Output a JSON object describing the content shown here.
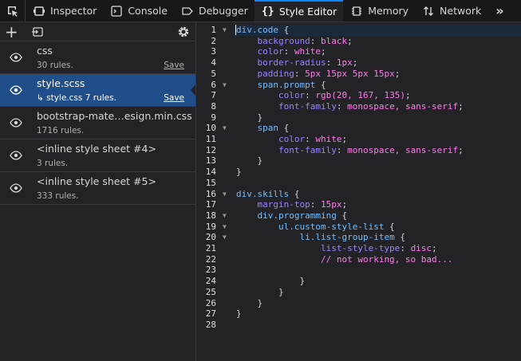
{
  "toolbar": {
    "tabs": [
      {
        "label": "Inspector",
        "icon": "inspector-icon"
      },
      {
        "label": "Console",
        "icon": "console-icon"
      },
      {
        "label": "Debugger",
        "icon": "debugger-icon"
      },
      {
        "label": "Style Editor",
        "icon": "style-editor-icon",
        "selected": true
      },
      {
        "label": "Memory",
        "icon": "memory-icon"
      },
      {
        "label": "Network",
        "icon": "network-icon"
      }
    ],
    "more_label": "»"
  },
  "sidebar": {
    "add_label": "+",
    "sheets": [
      {
        "name": "css",
        "meta": "30 rules.",
        "save": "Save"
      },
      {
        "name": "style.scss",
        "meta": "↳ style.css  7 rules.",
        "save": "Save",
        "selected": true
      },
      {
        "name": "bootstrap-mate…esign.min.css",
        "meta": "1716 rules.",
        "save": ""
      },
      {
        "name": "<inline style sheet #4>",
        "meta": "3 rules.",
        "save": ""
      },
      {
        "name": "<inline style sheet #5>",
        "meta": "333 rules.",
        "save": ""
      }
    ]
  },
  "editor": {
    "lines": [
      {
        "n": "1",
        "fold": true,
        "code": "div.code {"
      },
      {
        "n": "2",
        "code": "    background: black;"
      },
      {
        "n": "3",
        "code": "    color: white;"
      },
      {
        "n": "4",
        "code": "    border-radius: 1px;"
      },
      {
        "n": "5",
        "code": "    padding: 5px 15px 5px 15px;"
      },
      {
        "n": "6",
        "fold": true,
        "code": "    span.prompt {"
      },
      {
        "n": "7",
        "code": "        color: rgb(20, 167, 135);"
      },
      {
        "n": "8",
        "code": "        font-family: monospace, sans-serif;"
      },
      {
        "n": "9",
        "code": "    }"
      },
      {
        "n": "10",
        "fold": true,
        "code": "    span {"
      },
      {
        "n": "11",
        "code": "        color: white;"
      },
      {
        "n": "12",
        "code": "        font-family: monospace, sans-serif;"
      },
      {
        "n": "13",
        "code": "    }"
      },
      {
        "n": "14",
        "code": "}"
      },
      {
        "n": "15",
        "code": ""
      },
      {
        "n": "16",
        "fold": true,
        "code": "div.skills {"
      },
      {
        "n": "17",
        "code": "    margin-top: 15px;"
      },
      {
        "n": "18",
        "fold": true,
        "code": "    div.programming {"
      },
      {
        "n": "19",
        "fold": true,
        "code": "        ul.custom-style-list {"
      },
      {
        "n": "20",
        "fold": true,
        "code": "            li.list-group-item {"
      },
      {
        "n": "21",
        "code": "                list-style-type: disc;"
      },
      {
        "n": "22",
        "code": "                // not working, so bad..."
      },
      {
        "n": "23",
        "code": ""
      },
      {
        "n": "24",
        "code": "            }"
      },
      {
        "n": "25",
        "code": "        }"
      },
      {
        "n": "26",
        "code": "    }"
      },
      {
        "n": "27",
        "code": "}"
      },
      {
        "n": "28",
        "code": ""
      }
    ]
  }
}
